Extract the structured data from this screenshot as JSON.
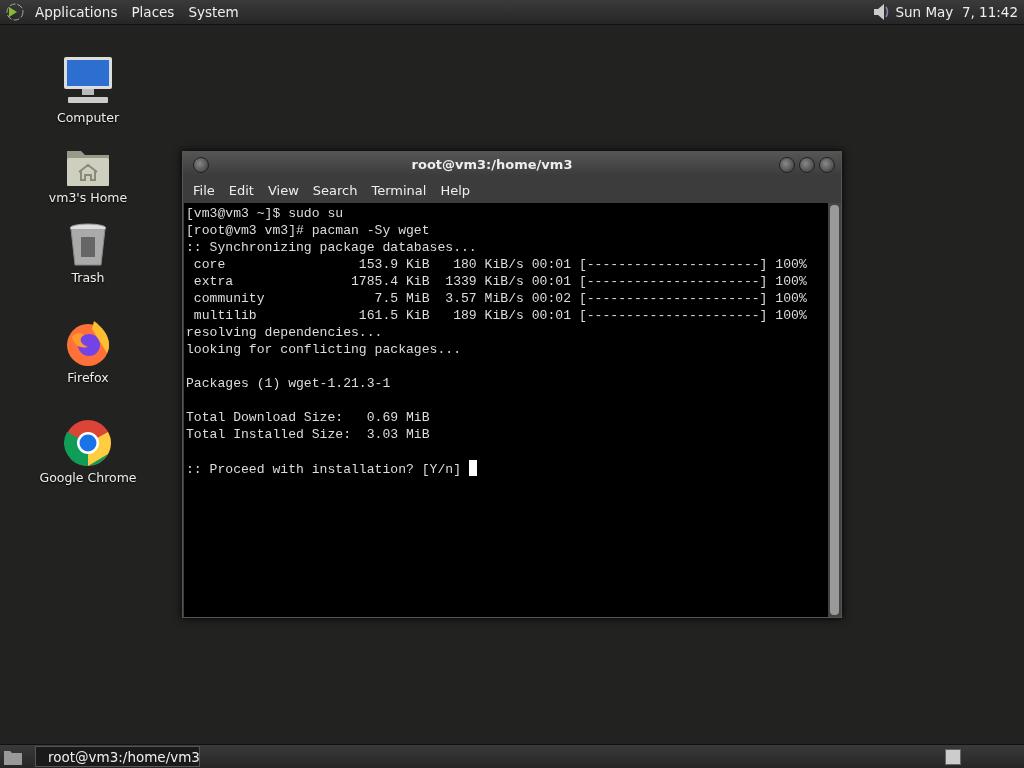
{
  "top_panel": {
    "menus": [
      "Applications",
      "Places",
      "System"
    ],
    "clock": "Sun May  7, 11:42"
  },
  "desktop_icons": [
    {
      "kind": "computer",
      "label": "Computer"
    },
    {
      "kind": "home",
      "label": "vm3's Home"
    },
    {
      "kind": "trash",
      "label": "Trash"
    },
    {
      "kind": "firefox",
      "label": "Firefox"
    },
    {
      "kind": "chrome",
      "label": "Google Chrome"
    }
  ],
  "terminal": {
    "title": "root@vm3:/home/vm3",
    "menu": [
      "File",
      "Edit",
      "View",
      "Search",
      "Terminal",
      "Help"
    ],
    "blocks": [
      [
        "[vm3@vm3 ~]$ sudo su",
        "[root@vm3 vm3]# pacman -Sy wget",
        ":: Synchronizing package databases...",
        " core                 153.9 KiB   180 KiB/s 00:01 [----------------------] 100%",
        " extra               1785.4 KiB  1339 KiB/s 00:01 [----------------------] 100%",
        " community              7.5 MiB  3.57 MiB/s 00:02 [----------------------] 100%",
        " multilib             161.5 KiB   189 KiB/s 00:01 [----------------------] 100%",
        "resolving dependencies...",
        "looking for conflicting packages..."
      ],
      [
        "Packages (1) wget-1.21.3-1"
      ],
      [
        "Total Download Size:   0.69 MiB",
        "Total Installed Size:  3.03 MiB"
      ],
      [
        ":: Proceed with installation? [Y/n] "
      ]
    ],
    "cursor_visible": true
  },
  "taskbar": {
    "tasks": [
      {
        "label": "root@vm3:/home/vm3",
        "selected": true
      }
    ]
  }
}
